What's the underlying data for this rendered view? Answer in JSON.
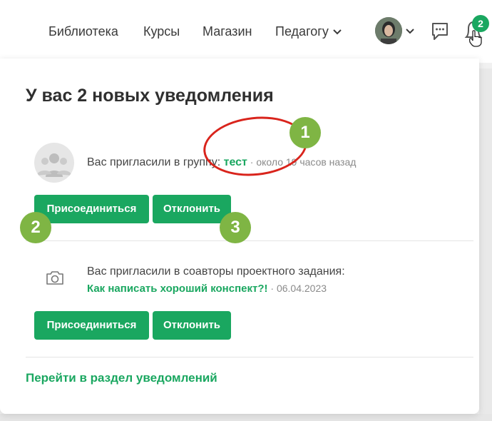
{
  "nav": {
    "items": [
      "Библиотека",
      "Курсы",
      "Магазин"
    ],
    "dropdown_label": "Педагогу",
    "notification_count": "2"
  },
  "panel": {
    "title": "У вас 2 новых уведомления",
    "notifications": [
      {
        "text": "Вас пригласили в группу: ",
        "link": "тест",
        "time": " · около 19 часов назад",
        "join_label": "Присоединиться",
        "decline_label": "Отклонить"
      },
      {
        "text": "Вас пригласили в соавторы проектного задания:",
        "link": "Как написать хороший конспект?!",
        "time": " · 06.04.2023",
        "join_label": "Присоединиться",
        "decline_label": "Отклонить"
      }
    ],
    "footer_link": "Перейти в раздел уведомлений"
  },
  "annotations": {
    "marker_1": "1",
    "marker_2": "2",
    "marker_3": "3"
  },
  "colors": {
    "accent": "#1aa760",
    "marker": "#7fb544",
    "highlight": "#d9241c"
  }
}
